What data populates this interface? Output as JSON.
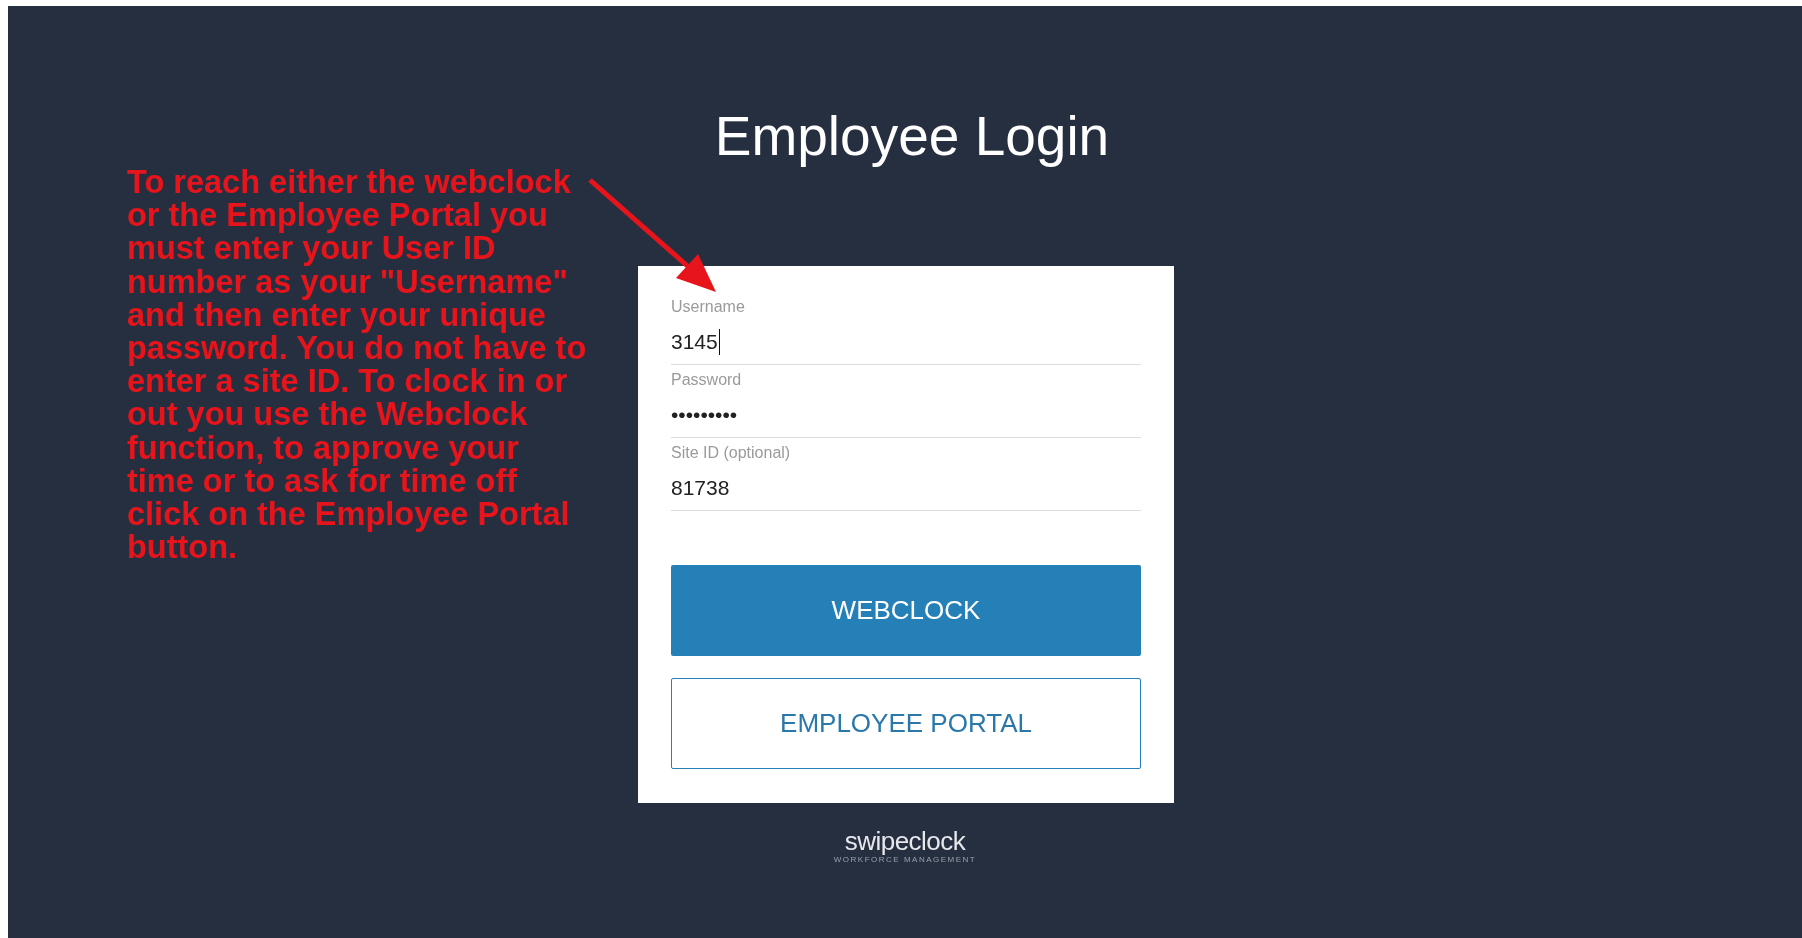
{
  "title": "Employee Login",
  "annotation": {
    "text": "To reach either the webclock or the Employee Portal you must enter your User ID number as your \"Username\" and then enter your unique password. You do not have to enter a site ID. To clock in or out you use the Webclock function, to approve your time or to ask for time off click on the Employee Portal button."
  },
  "fields": [
    {
      "label": "Username",
      "value": "3145",
      "focused": true
    },
    {
      "label": "Password",
      "value": "•••••••••",
      "focused": false
    },
    {
      "label": "Site ID (optional)",
      "value": "81738",
      "focused": false
    }
  ],
  "buttons": [
    {
      "label": "WEBCLOCK",
      "kind": "primary"
    },
    {
      "label": "EMPLOYEE PORTAL",
      "kind": "outline"
    }
  ],
  "logo": {
    "name": "swipeclock",
    "tagline": "WORKFORCE MANAGEMENT"
  }
}
